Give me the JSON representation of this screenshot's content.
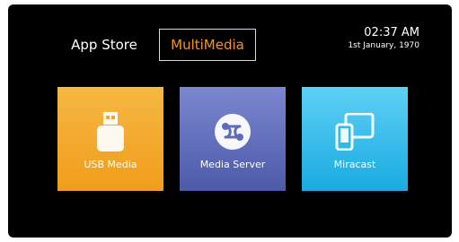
{
  "nav": {
    "tabs": [
      {
        "label": "App Store"
      },
      {
        "label": "MultiMedia"
      }
    ],
    "active_tab": "MultiMedia",
    "accent_color": "#f0952a"
  },
  "clock": {
    "time": "02:37 AM",
    "date": "1st January, 1970"
  },
  "tiles": [
    {
      "label": "USB Media",
      "icon": "usb-drive-icon",
      "color": "#f2a82c"
    },
    {
      "label": "Media Server",
      "icon": "media-server-icon",
      "color": "#5f6bb8"
    },
    {
      "label": "Miracast",
      "icon": "miracast-devices-icon",
      "color": "#2fb9e9"
    }
  ]
}
